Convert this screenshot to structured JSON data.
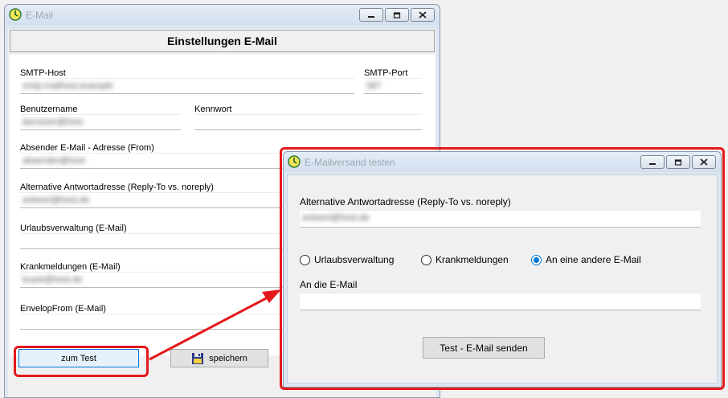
{
  "main_window": {
    "title": "E-Mail",
    "header": "Einstellungen E-Mail",
    "fields": {
      "smtp_host_label": "SMTP-Host",
      "smtp_port_label": "SMTP-Port",
      "username_label": "Benutzername",
      "password_label": "Kennwort",
      "sender_label": "Absender E-Mail - Adresse (From)",
      "reply_to_label": "Alternative Antwortadresse (Reply-To vs. noreply)",
      "vacation_label": "Urlaubsverwaltung (E-Mail)",
      "sick_label": "Krankmeldungen (E-Mail)",
      "envelope_label": "EnvelopFrom (E-Mail)"
    },
    "buttons": {
      "test_label": "zum Test",
      "save_label": "speichern"
    }
  },
  "dialog": {
    "title": "E-Mailversand testen",
    "reply_to_label": "Alternative Antwortadresse (Reply-To vs. noreply)",
    "options": [
      "Urlaubsverwaltung",
      "Krankmeldungen",
      "An eine andere E-Mail"
    ],
    "selected_option": "An eine andere E-Mail",
    "recipient_label": "An die E-Mail",
    "recipient_value": "",
    "send_label": "Test - E-Mail senden"
  },
  "icons": {
    "app": "clock-globe-icon",
    "save": "floppy-disk-icon",
    "minimize": "minimize-icon",
    "maximize": "maximize-icon",
    "close": "close-icon"
  },
  "colors": {
    "highlight": "#e4191c",
    "accent": "#0078d7",
    "title_text": "#9da7b3"
  }
}
